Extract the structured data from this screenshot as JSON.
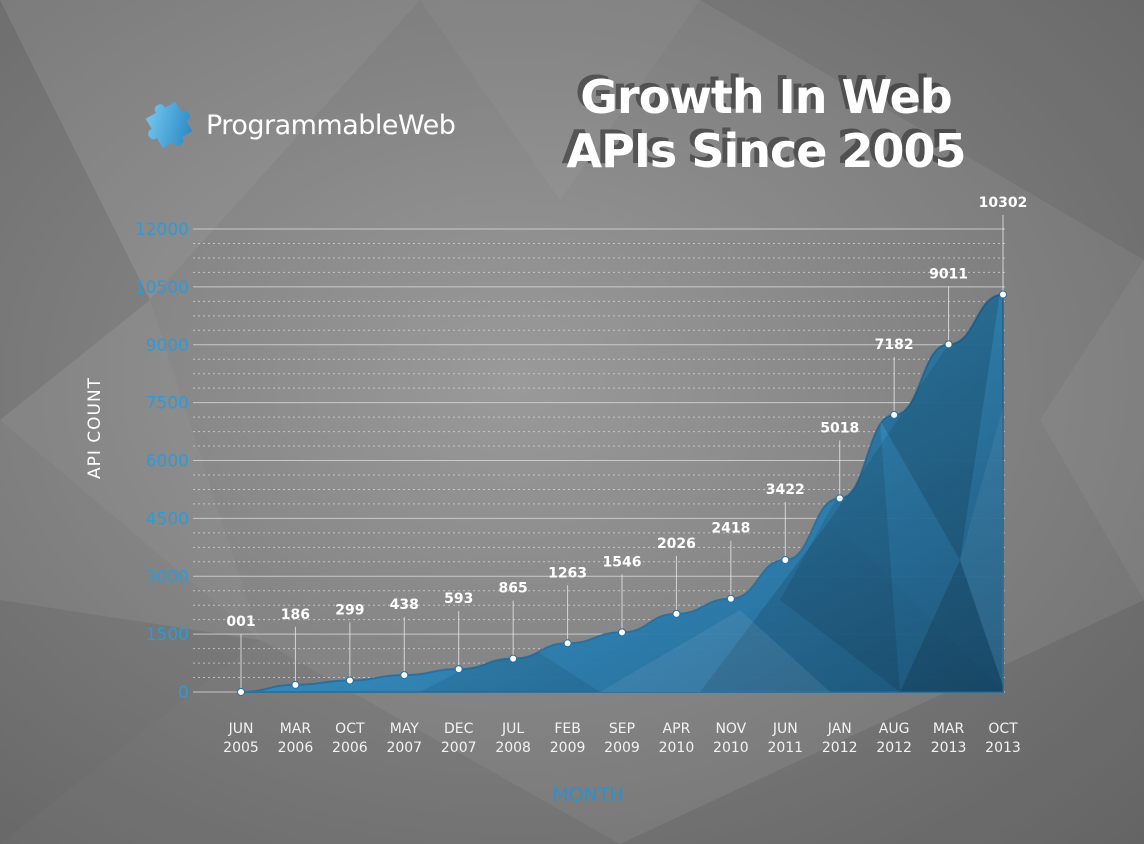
{
  "brand": {
    "logo_text": "ProgrammableWeb",
    "logo_icon": "puzzle-piece-icon",
    "accent_color": "#2e9ad6"
  },
  "title": {
    "line1": "Growth In Web",
    "line2": "APIs Since 2005"
  },
  "chart_data": {
    "type": "area",
    "title": "Growth In Web APIs Since 2005",
    "xlabel": "MONTH",
    "ylabel": "API COUNT",
    "ylim": [
      0,
      12000
    ],
    "yticks": [
      0,
      1500,
      3000,
      4500,
      6000,
      7500,
      9000,
      10500,
      12000
    ],
    "grid": true,
    "categories": [
      [
        "JUN",
        "2005"
      ],
      [
        "MAR",
        "2006"
      ],
      [
        "OCT",
        "2006"
      ],
      [
        "MAY",
        "2007"
      ],
      [
        "DEC",
        "2007"
      ],
      [
        "JUL",
        "2008"
      ],
      [
        "FEB",
        "2009"
      ],
      [
        "SEP",
        "2009"
      ],
      [
        "APR",
        "2010"
      ],
      [
        "NOV",
        "2010"
      ],
      [
        "JUN",
        "2011"
      ],
      [
        "JAN",
        "2012"
      ],
      [
        "AUG",
        "2012"
      ],
      [
        "MAR",
        "2013"
      ],
      [
        "OCT",
        "2013"
      ]
    ],
    "values": [
      1,
      186,
      299,
      438,
      593,
      865,
      1263,
      1546,
      2026,
      2418,
      3422,
      5018,
      7182,
      9011,
      10302
    ],
    "data_labels": [
      "001",
      "186",
      "299",
      "438",
      "593",
      "865",
      "1263",
      "1546",
      "2026",
      "2418",
      "3422",
      "5018",
      "7182",
      "9011",
      "10302"
    ],
    "fill_color": "#2e7fb0",
    "line_color": "#2a6f9c"
  }
}
